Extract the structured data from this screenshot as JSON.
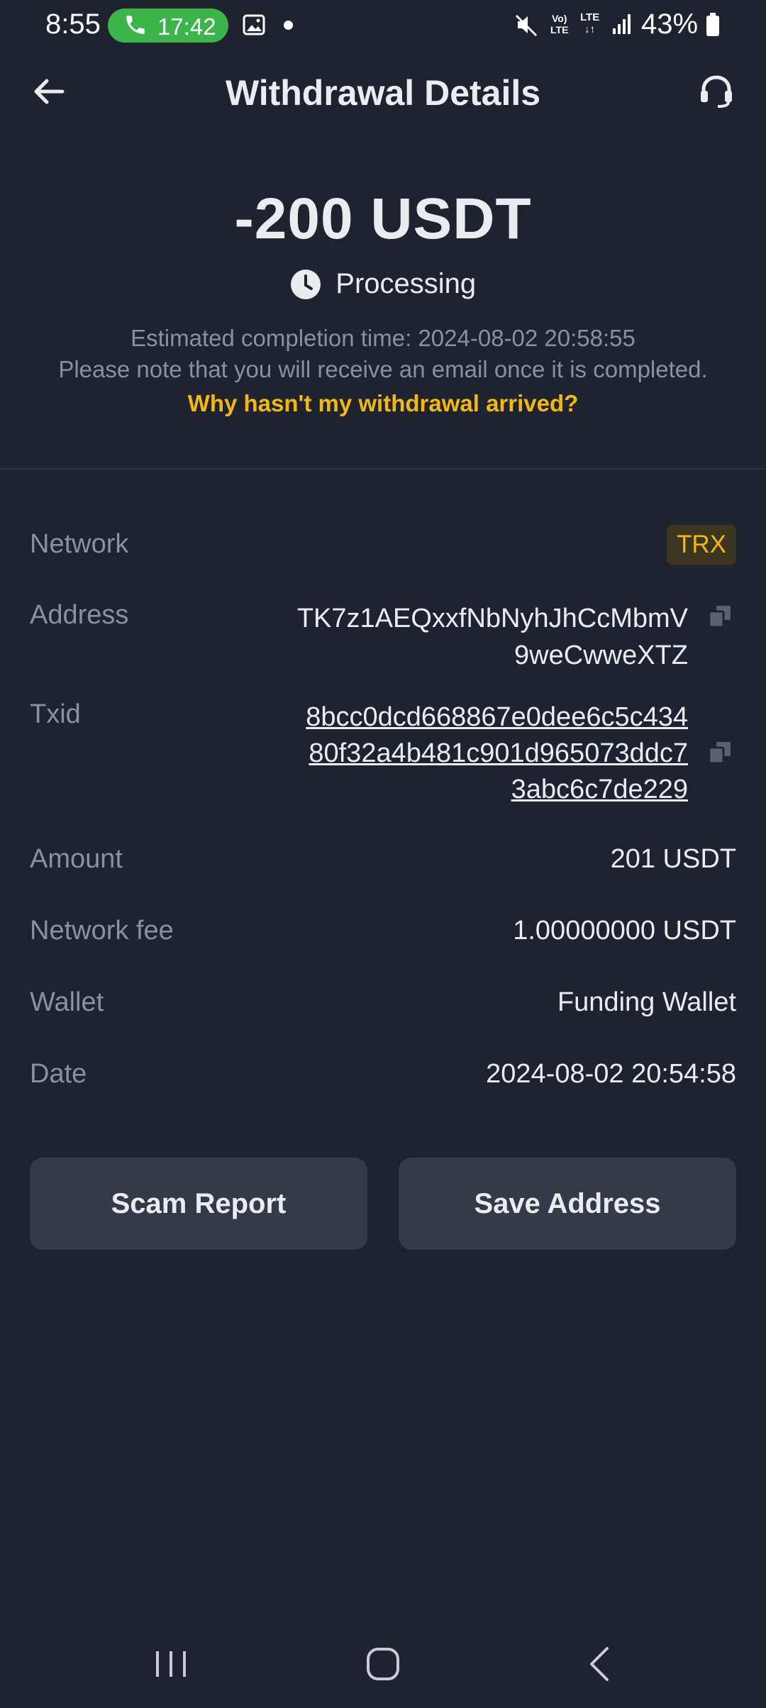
{
  "status_bar": {
    "time": "8:55",
    "call_duration": "17:42",
    "volte_line1": "Vo)",
    "volte_line2": "LTE",
    "lte_label": "LTE",
    "battery": "43%",
    "icons": [
      "phone-icon",
      "gallery-icon",
      "mute-icon",
      "signal-icon",
      "battery-icon"
    ]
  },
  "header": {
    "title": "Withdrawal Details",
    "icons": [
      "back-arrow-icon",
      "headset-support-icon"
    ]
  },
  "summary": {
    "amount": "-200 USDT",
    "status": "Processing",
    "estimated_completion": "Estimated completion time: 2024-08-02 20:58:55",
    "email_note": "Please note that you will receive an email once it is completed.",
    "help_link": "Why hasn't my withdrawal arrived?"
  },
  "details": {
    "network_label": "Network",
    "network_value": "TRX",
    "address_label": "Address",
    "address_line1": "TK7z1AEQxxfNbNyhJhCcMbmV",
    "address_line2": "9weCwweXTZ",
    "txid_label": "Txid",
    "txid_line1": "8bcc0dcd668867e0dee6c5c434",
    "txid_line2": "80f32a4b481c901d965073ddc7",
    "txid_line3": "3abc6c7de229",
    "amount_label": "Amount",
    "amount_value": "201 USDT",
    "fee_label": "Network fee",
    "fee_value": "1.00000000 USDT",
    "wallet_label": "Wallet",
    "wallet_value": "Funding Wallet",
    "date_label": "Date",
    "date_value": "2024-08-02 20:54:58"
  },
  "actions": {
    "scam_report": "Scam Report",
    "save_address": "Save Address"
  },
  "nav": {
    "icons": [
      "recent-apps-icon",
      "home-icon",
      "back-icon"
    ]
  },
  "colors": {
    "background": "#1f2330",
    "accent": "#f0b90b",
    "muted_text": "#8a919e",
    "button_bg": "#343a46",
    "call_pill": "#3bb54a"
  }
}
